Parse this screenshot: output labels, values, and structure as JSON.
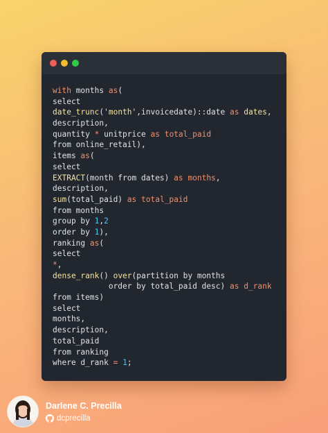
{
  "window": {
    "buttons": [
      {
        "name": "close",
        "color": "#ee5f57"
      },
      {
        "name": "minimize",
        "color": "#f3bc2e"
      },
      {
        "name": "maximize",
        "color": "#2fcd45"
      }
    ]
  },
  "theme": {
    "keyword": "#f0916c",
    "function": "#f2e3a2",
    "string": "#f2e3a2",
    "operator": "#ff8a65",
    "number": "#4ac7f2",
    "text": "#dfe3ea"
  },
  "code": [
    [
      [
        "kw",
        "with"
      ],
      [
        "tx",
        " months "
      ],
      [
        "kw",
        "as"
      ],
      [
        "tx",
        "("
      ]
    ],
    [
      [
        "tx",
        "select"
      ]
    ],
    [
      [
        "fn",
        "date_trunc"
      ],
      [
        "tx",
        "("
      ],
      [
        "str",
        "'month'"
      ],
      [
        "tx",
        ",invoicedate)::date "
      ],
      [
        "kw",
        "as"
      ],
      [
        "tx",
        " "
      ],
      [
        "fn",
        "dates"
      ],
      [
        "tx",
        ","
      ]
    ],
    [
      [
        "tx",
        "description,"
      ]
    ],
    [
      [
        "tx",
        "quantity "
      ],
      [
        "op",
        "*"
      ],
      [
        "tx",
        " unitprice "
      ],
      [
        "kw",
        "as"
      ],
      [
        "tx",
        " "
      ],
      [
        "kw",
        "total_paid"
      ]
    ],
    [
      [
        "tx",
        "from online_retail),"
      ]
    ],
    [
      [
        "tx",
        "items "
      ],
      [
        "kw",
        "as"
      ],
      [
        "tx",
        "("
      ]
    ],
    [
      [
        "tx",
        "select"
      ]
    ],
    [
      [
        "fn",
        "EXTRACT"
      ],
      [
        "tx",
        "(month from dates) "
      ],
      [
        "kw",
        "as"
      ],
      [
        "tx",
        " "
      ],
      [
        "kw",
        "months"
      ],
      [
        "tx",
        ","
      ]
    ],
    [
      [
        "tx",
        "description,"
      ]
    ],
    [
      [
        "fn",
        "sum"
      ],
      [
        "tx",
        "(total_paid) "
      ],
      [
        "kw",
        "as"
      ],
      [
        "tx",
        " "
      ],
      [
        "kw",
        "total_paid"
      ]
    ],
    [
      [
        "tx",
        "from months"
      ]
    ],
    [
      [
        "tx",
        "group by "
      ],
      [
        "num",
        "1"
      ],
      [
        "tx",
        ","
      ],
      [
        "num",
        "2"
      ]
    ],
    [
      [
        "tx",
        "order by "
      ],
      [
        "num",
        "1"
      ],
      [
        "tx",
        "),"
      ]
    ],
    [
      [
        "tx",
        "ranking "
      ],
      [
        "kw",
        "as"
      ],
      [
        "tx",
        "("
      ]
    ],
    [
      [
        "tx",
        "select"
      ]
    ],
    [
      [
        "op",
        "*"
      ],
      [
        "tx",
        ","
      ]
    ],
    [
      [
        "fn",
        "dense_rank"
      ],
      [
        "tx",
        "() "
      ],
      [
        "fn",
        "over"
      ],
      [
        "tx",
        "(partition by months"
      ]
    ],
    [
      [
        "tx",
        "            order by total_paid desc) "
      ],
      [
        "kw",
        "as"
      ],
      [
        "tx",
        " "
      ],
      [
        "kw",
        "d_rank"
      ]
    ],
    [
      [
        "tx",
        "from items)"
      ]
    ],
    [
      [
        "tx",
        "select"
      ]
    ],
    [
      [
        "tx",
        "months,"
      ]
    ],
    [
      [
        "tx",
        "description,"
      ]
    ],
    [
      [
        "tx",
        "total_paid"
      ]
    ],
    [
      [
        "tx",
        "from ranking"
      ]
    ],
    [
      [
        "tx",
        "where d_rank "
      ],
      [
        "op",
        "="
      ],
      [
        "tx",
        " "
      ],
      [
        "num",
        "1"
      ],
      [
        "tx",
        ";"
      ]
    ]
  ],
  "author": {
    "name": "Darlene C. Precilla",
    "handle": "dcprecilla",
    "handle_icon": "github-icon"
  }
}
